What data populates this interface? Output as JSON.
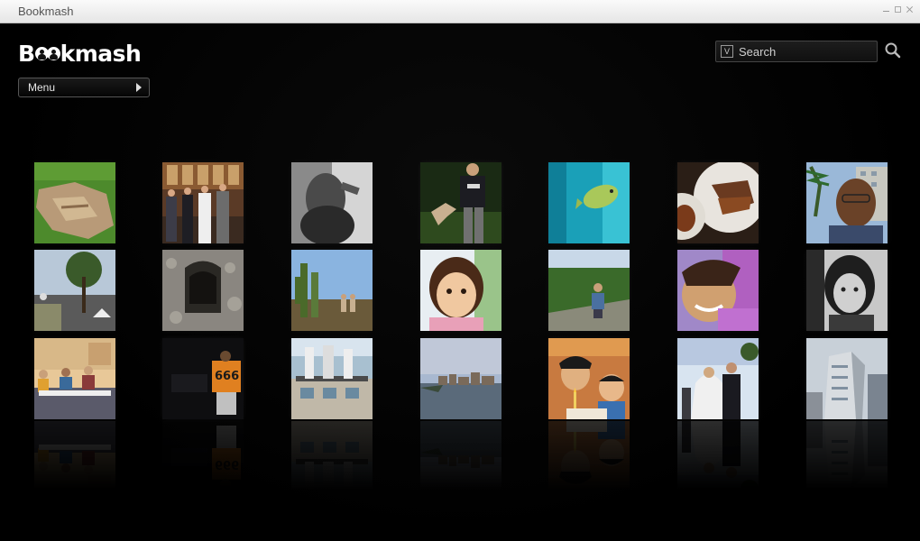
{
  "window": {
    "title": "Bookmash"
  },
  "logo": {
    "text_first": "B",
    "text_rest": "kmash"
  },
  "menu": {
    "label": "Menu"
  },
  "search": {
    "placeholder": "Search",
    "badge": "V"
  },
  "photos": [
    [
      "fabric-on-grass",
      "wedding-group",
      "blurry-figure-bw",
      "man-with-lizard",
      "underwater-fish",
      "food-plates",
      "man-portrait-city"
    ],
    [
      "street-with-tree",
      "stone-tunnel",
      "cactus-landscape",
      "toddler-face",
      "man-on-hillside",
      "smiling-child-purple",
      "girl-portrait-bw"
    ],
    [
      "people-at-table",
      "person-orange-jersey",
      "market-stall",
      "waterfront-city",
      "kids-birthday-cake",
      "bride-and-groom",
      "modern-building"
    ]
  ]
}
